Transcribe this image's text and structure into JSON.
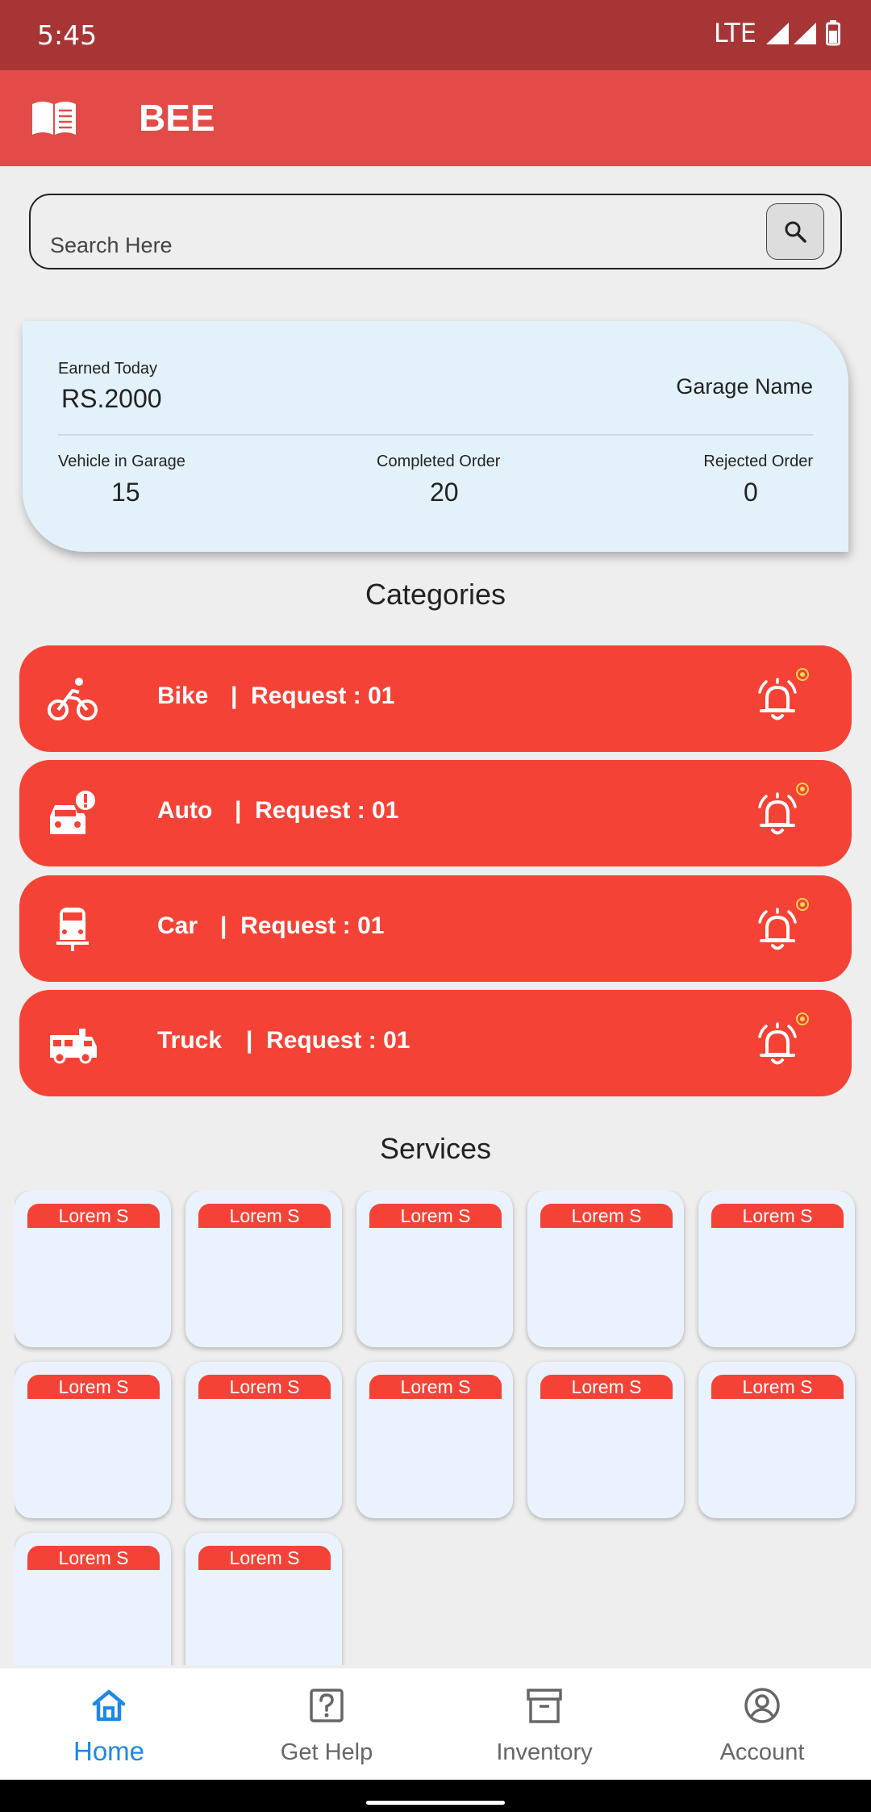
{
  "status_bar": {
    "time": "5:45",
    "network": "LTE"
  },
  "app_bar": {
    "title": "BEE",
    "icon": "menu-book-icon"
  },
  "search": {
    "placeholder": "Search Here",
    "icon": "search-icon"
  },
  "stats_card": {
    "earned_label": "Earned Today",
    "earned_value": "RS.2000",
    "garage_name": "Garage Name",
    "vehicle_label": "Vehicle in Garage",
    "vehicle_value": "15",
    "completed_label": "Completed Order",
    "completed_value": "20",
    "rejected_label": "Rejected Order",
    "rejected_value": "0"
  },
  "categories": {
    "title": "Categories",
    "accent_color": "#f44336",
    "items": [
      {
        "name": "Bike",
        "request": "|  Request : 01",
        "icon": "bike-icon"
      },
      {
        "name": "Auto",
        "request": "|  Request : 01",
        "icon": "auto-icon"
      },
      {
        "name": "Car",
        "request": "|  Request : 01",
        "icon": "car-icon"
      },
      {
        "name": "Truck",
        "request": "|  Request : 01",
        "icon": "truck-icon"
      }
    ]
  },
  "services": {
    "title": "Services",
    "items": [
      "Lorem S",
      "Lorem S",
      "Lorem S",
      "Lorem S",
      "Lorem S",
      "Lorem S",
      "Lorem S",
      "Lorem S",
      "Lorem S",
      "Lorem S",
      "Lorem S",
      "Lorem S"
    ]
  },
  "bottom_nav": {
    "active_color": "#1e88e5",
    "items": [
      {
        "label": "Home",
        "icon": "home-icon",
        "active": true
      },
      {
        "label": "Get Help",
        "icon": "help-icon",
        "active": false
      },
      {
        "label": "Inventory",
        "icon": "inventory-icon",
        "active": false
      },
      {
        "label": "Account",
        "icon": "account-icon",
        "active": false
      }
    ]
  }
}
